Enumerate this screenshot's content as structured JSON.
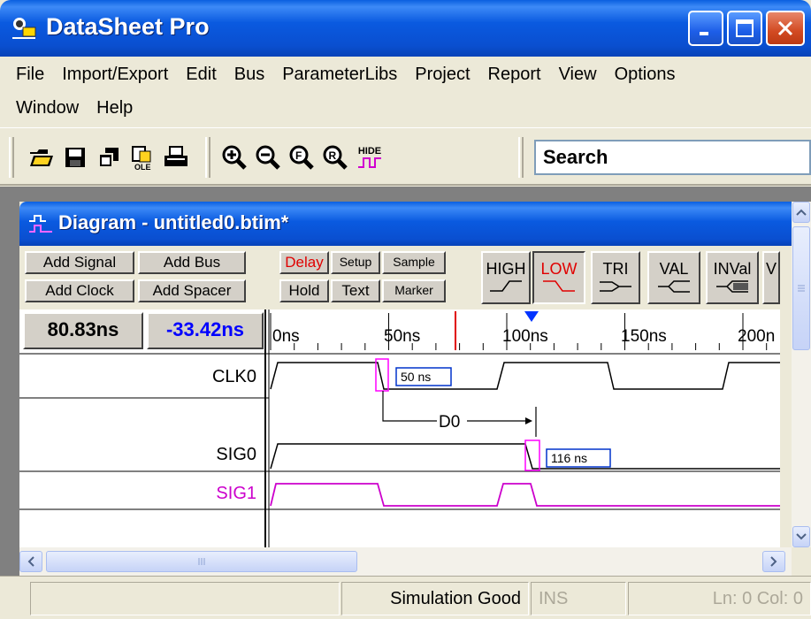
{
  "window": {
    "title": "DataSheet Pro"
  },
  "menu": {
    "row1": [
      "File",
      "Import/Export",
      "Edit",
      "Bus",
      "ParameterLibs",
      "Project",
      "Report",
      "View",
      "Options"
    ],
    "row2": [
      "Window",
      "Help"
    ]
  },
  "toolbar": {
    "icons": [
      "open-folder-icon",
      "save-disk-icon",
      "copy-windows-icon",
      "paste-ole-icon",
      "print-icon",
      "zoom-in-icon",
      "zoom-out-icon",
      "zoom-fit-icon",
      "zoom-reset-icon",
      "hide-waveform-icon"
    ],
    "hide_label": "HIDE",
    "search_placeholder": "Search"
  },
  "diagram": {
    "title": "Diagram - untitled0.btim*",
    "buttons": {
      "add_signal": "Add Signal",
      "add_bus": "Add Bus",
      "add_clock": "Add Clock",
      "add_spacer": "Add Spacer",
      "delay": "Delay",
      "setup": "Setup",
      "sample": "Sample",
      "hold": "Hold",
      "text": "Text",
      "marker": "Marker"
    },
    "states": [
      "HIGH",
      "LOW",
      "TRI",
      "VAL",
      "INVal",
      "V"
    ],
    "active_state": "LOW",
    "cursor_time": "80.83ns",
    "delta_time": "-33.42ns",
    "time_ticks": [
      "0ns",
      "50ns",
      "100ns",
      "150ns",
      "200n"
    ],
    "signals": [
      {
        "name": "CLK0",
        "color": "#000000"
      },
      {
        "name": "SIG0",
        "color": "#000000"
      },
      {
        "name": "SIG1",
        "color": "#cc00cc"
      }
    ],
    "annotations": {
      "clk_delay": "50 ns",
      "sig_delay": "116 ns",
      "delay_name": "D0"
    }
  },
  "status": {
    "message": "Simulation Good",
    "mode": "INS",
    "position": "Ln: 0  Col: 0"
  },
  "colors": {
    "titlebar": "#0a5ae0",
    "sig1": "#cc00cc",
    "marker_red": "#e00000",
    "marker_blue": "#0033ff",
    "delta_blue": "#0000ff"
  }
}
